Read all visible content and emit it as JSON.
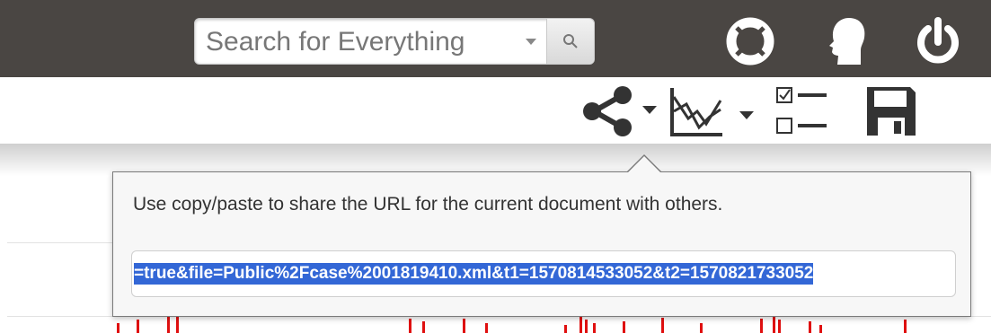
{
  "header": {
    "search": {
      "placeholder": "Search for Everything"
    },
    "icons": [
      "help-lifebuoy-icon",
      "user-profile-icon",
      "power-icon"
    ]
  },
  "toolbar": {
    "icons": [
      "share-icon",
      "chart-type-icon",
      "checklist-icon",
      "save-icon"
    ]
  },
  "share_popover": {
    "message": "Use copy/paste to share the URL for the current document with others.",
    "url_text": "=true&file=Public%2Fcase%2001819410.xml&t1=1570814533052&t2=1570821733052"
  },
  "colors": {
    "topbar": "#4a4643",
    "selection": "#3367d6",
    "chart_ticks": "#e01010"
  }
}
